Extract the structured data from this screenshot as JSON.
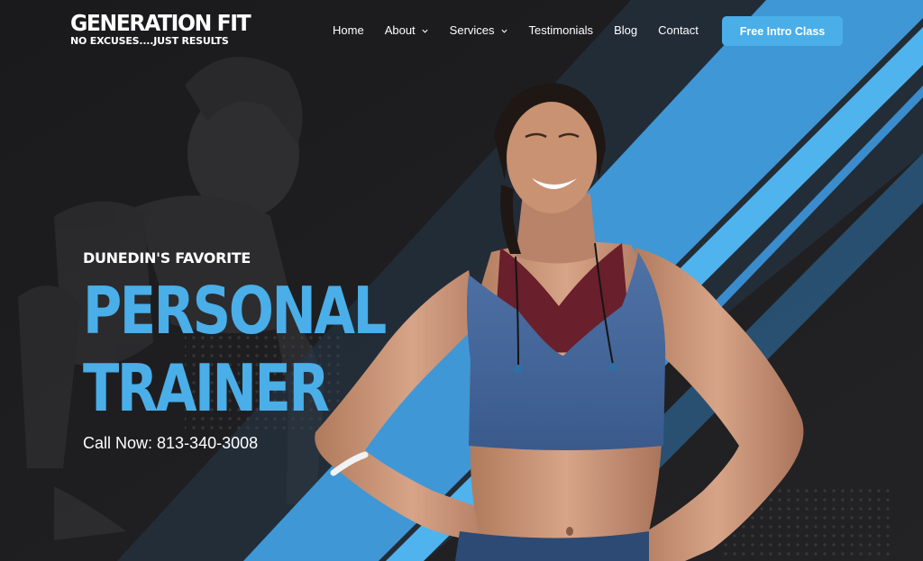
{
  "brand": {
    "name": "GENERATION FIT",
    "tagline": "NO EXCUSES....JUST RESULTS"
  },
  "nav": {
    "items": [
      {
        "label": "Home",
        "has_dropdown": false
      },
      {
        "label": "About",
        "has_dropdown": true
      },
      {
        "label": "Services",
        "has_dropdown": true
      },
      {
        "label": "Testimonials",
        "has_dropdown": false
      },
      {
        "label": "Blog",
        "has_dropdown": false
      },
      {
        "label": "Contact",
        "has_dropdown": false
      }
    ],
    "cta_label": "Free Intro Class"
  },
  "hero": {
    "eyebrow": "DUNEDIN'S FAVORITE",
    "headline_line1": "PERSONAL",
    "headline_line2": "TRAINER",
    "phone_label": "Call Now:",
    "phone_number": "813-340-3008",
    "image_subject": "smiling woman in blue sports bra, hands on hips",
    "background_image_subject": "woman in sprint start position"
  },
  "colors": {
    "accent": "#4aaee8",
    "background": "#1c1c1e",
    "text": "#ffffff"
  }
}
